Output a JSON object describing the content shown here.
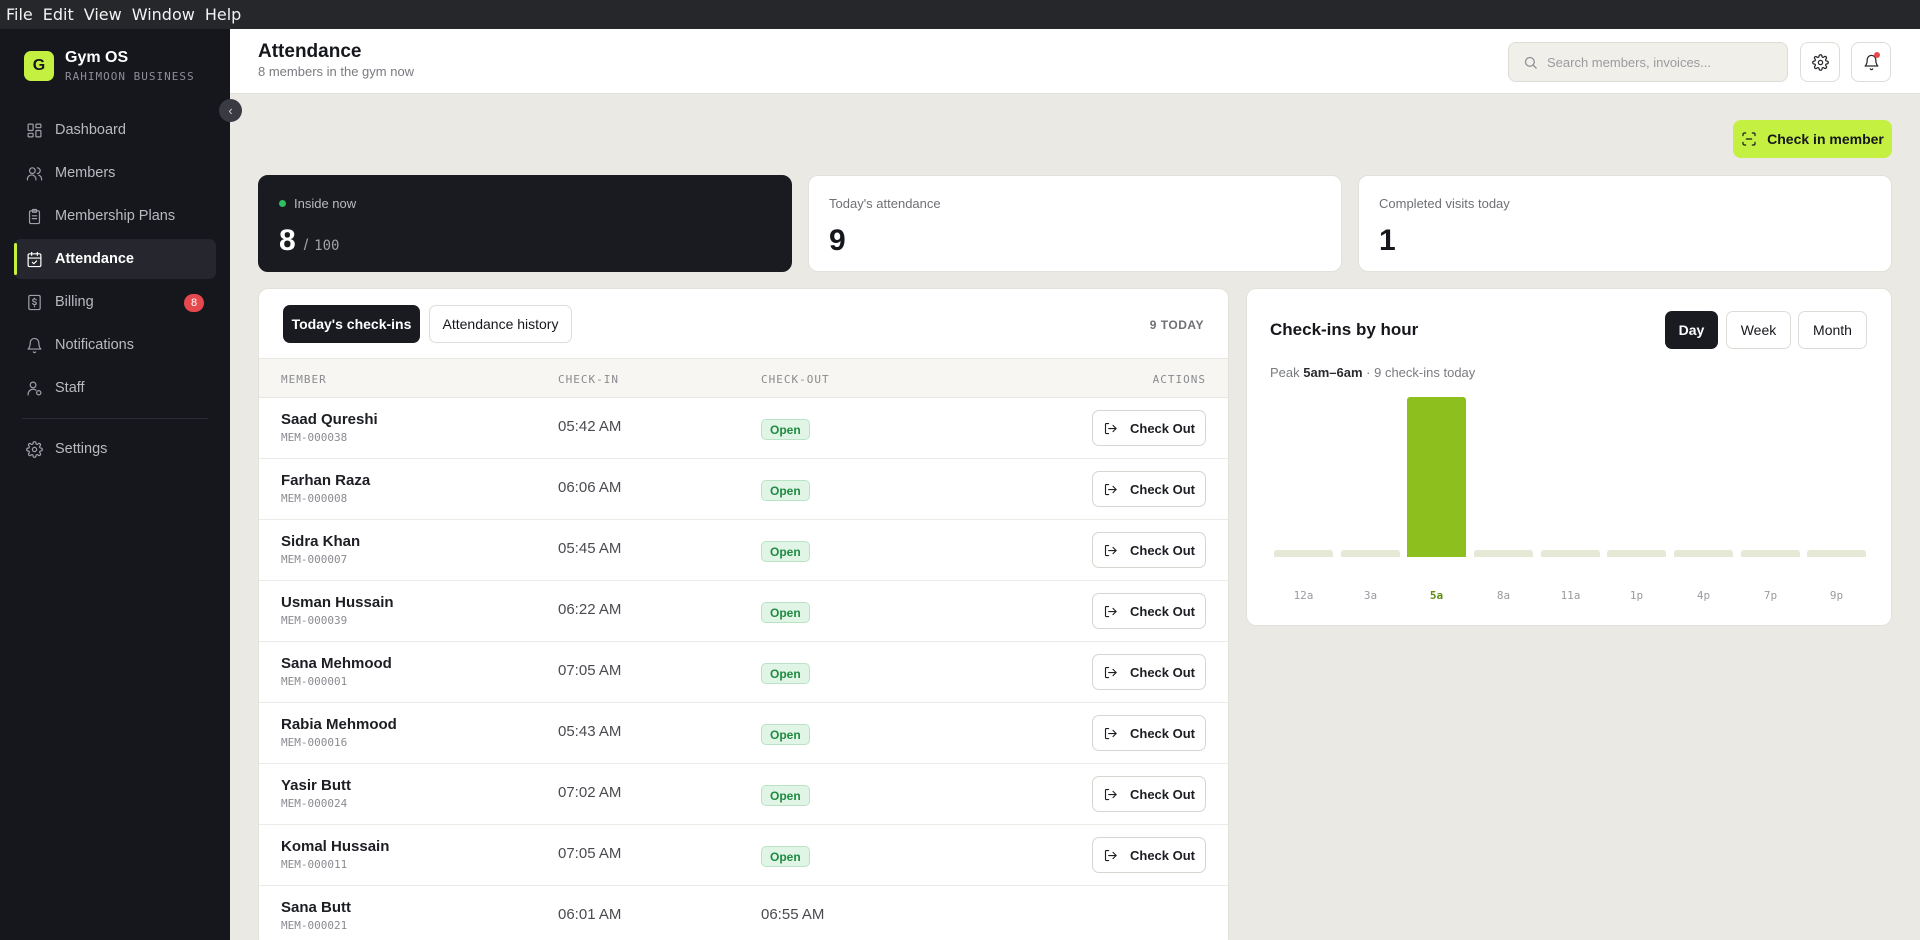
{
  "menubar": [
    "File",
    "Edit",
    "View",
    "Window",
    "Help"
  ],
  "brand": {
    "logo_letter": "G",
    "name": "Gym OS",
    "subtitle": "RAHIMOON BUSINESS"
  },
  "sidebar": {
    "items": [
      {
        "label": "Dashboard",
        "icon": "grid-icon"
      },
      {
        "label": "Members",
        "icon": "users-icon"
      },
      {
        "label": "Membership Plans",
        "icon": "clipboard-icon"
      },
      {
        "label": "Attendance",
        "icon": "calendar-check-icon",
        "active": true
      },
      {
        "label": "Billing",
        "icon": "billing-icon",
        "badge": "8"
      },
      {
        "label": "Notifications",
        "icon": "bell-icon"
      },
      {
        "label": "Staff",
        "icon": "staff-icon"
      }
    ],
    "settings_label": "Settings"
  },
  "header": {
    "title": "Attendance",
    "subtitle": "8 members in the gym now",
    "search_placeholder": "Search members, invoices..."
  },
  "actions": {
    "check_in_label": "Check in member"
  },
  "stats": {
    "inside": {
      "label": "Inside now",
      "value": "8",
      "capacity": "100"
    },
    "today": {
      "label": "Today's attendance",
      "value": "9"
    },
    "completed": {
      "label": "Completed visits today",
      "value": "1"
    }
  },
  "table": {
    "tabs": [
      "Today's check-ins",
      "Attendance history"
    ],
    "count_label": "9 TODAY",
    "columns": [
      "MEMBER",
      "CHECK-IN",
      "CHECK-OUT",
      "ACTIONS"
    ],
    "open_label": "Open",
    "checkout_label": "Check Out",
    "rows": [
      {
        "name": "Saad Qureshi",
        "id": "MEM-000038",
        "check_in": "05:42 AM",
        "check_out": null
      },
      {
        "name": "Farhan Raza",
        "id": "MEM-000008",
        "check_in": "06:06 AM",
        "check_out": null
      },
      {
        "name": "Sidra Khan",
        "id": "MEM-000007",
        "check_in": "05:45 AM",
        "check_out": null
      },
      {
        "name": "Usman Hussain",
        "id": "MEM-000039",
        "check_in": "06:22 AM",
        "check_out": null
      },
      {
        "name": "Sana Mehmood",
        "id": "MEM-000001",
        "check_in": "07:05 AM",
        "check_out": null
      },
      {
        "name": "Rabia Mehmood",
        "id": "MEM-000016",
        "check_in": "05:43 AM",
        "check_out": null
      },
      {
        "name": "Yasir Butt",
        "id": "MEM-000024",
        "check_in": "07:02 AM",
        "check_out": null
      },
      {
        "name": "Komal Hussain",
        "id": "MEM-000011",
        "check_in": "07:05 AM",
        "check_out": null
      },
      {
        "name": "Sana Butt",
        "id": "MEM-000021",
        "check_in": "06:01 AM",
        "check_out": "06:55 AM"
      }
    ]
  },
  "chart_panel": {
    "title": "Check-ins by hour",
    "ranges": [
      "Day",
      "Week",
      "Month"
    ],
    "active_range": "Day",
    "peak_prefix": "Peak",
    "peak_value": "5am–6am",
    "peak_suffix": "· 9 check-ins today"
  },
  "chart_data": {
    "type": "bar",
    "categories": [
      "12a",
      "3a",
      "5a",
      "8a",
      "11a",
      "1p",
      "4p",
      "7p",
      "9p"
    ],
    "values": [
      0,
      0,
      9,
      0,
      0,
      0,
      0,
      0,
      0
    ],
    "highlight": "5a",
    "colors": {
      "peak": "#8dbf1f",
      "empty": "#e4e8d4"
    }
  }
}
